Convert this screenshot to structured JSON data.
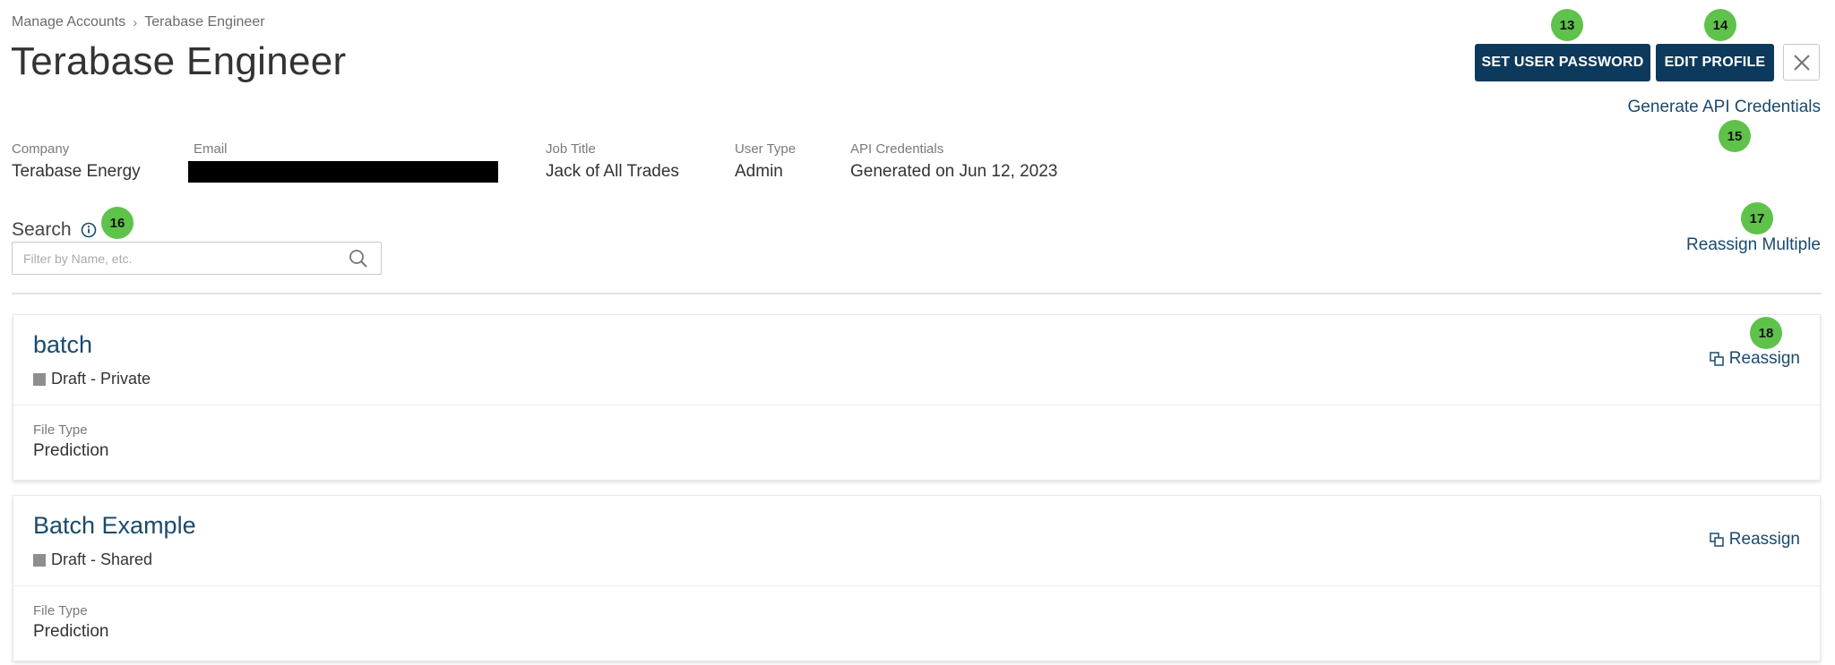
{
  "breadcrumb": {
    "root": "Manage Accounts",
    "current": "Terabase Engineer"
  },
  "page_title": "Terabase Engineer",
  "actions": {
    "set_password": "SET USER PASSWORD",
    "edit_profile": "EDIT PROFILE",
    "generate_api": "Generate API Credentials",
    "reassign_multiple": "Reassign Multiple"
  },
  "badges": {
    "b13": "13",
    "b14": "14",
    "b15": "15",
    "b16": "16",
    "b17": "17",
    "b18": "18"
  },
  "profile": {
    "company_label": "Company",
    "company": "Terabase Energy",
    "email_label": "Email",
    "job_title_label": "Job Title",
    "job_title": "Jack of All Trades",
    "user_type_label": "User Type",
    "user_type": "Admin",
    "api_label": "API Credentials",
    "api_value": "Generated on Jun 12, 2023"
  },
  "search": {
    "label": "Search",
    "placeholder": "Filter by Name, etc."
  },
  "files": [
    {
      "name": "batch",
      "status": "Draft - Private",
      "file_type_label": "File Type",
      "file_type": "Prediction",
      "reassign": "Reassign"
    },
    {
      "name": "Batch Example",
      "status": "Draft - Shared",
      "file_type_label": "File Type",
      "file_type": "Prediction",
      "reassign": "Reassign"
    }
  ],
  "colors": {
    "primary": "#0d3a5c",
    "link": "#1a4a6e",
    "badge": "#5fc24a",
    "status_draft": "#8e8e8e"
  }
}
